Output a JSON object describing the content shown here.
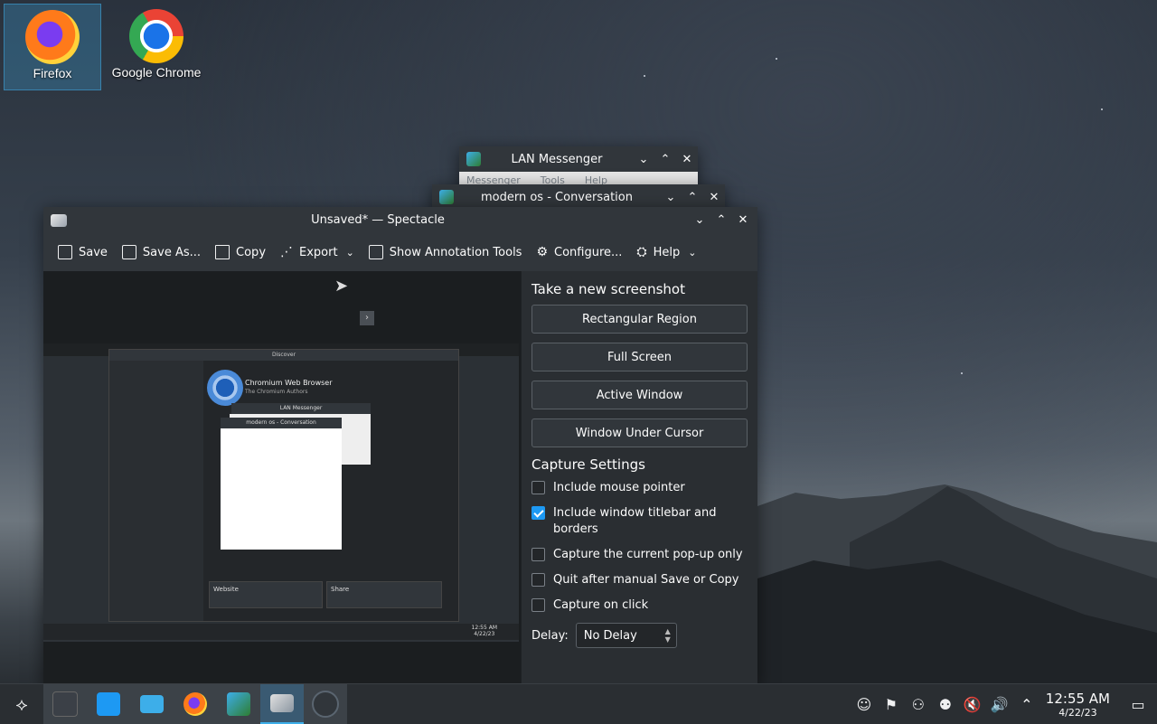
{
  "desktop": {
    "icons": [
      {
        "label": "Firefox",
        "icon": "firefox-icon"
      },
      {
        "label": "Google Chrome",
        "icon": "chrome-icon"
      }
    ]
  },
  "lan_messenger": {
    "title": "LAN Messenger",
    "menu": [
      "Messenger",
      "Tools",
      "Help"
    ]
  },
  "conversation": {
    "title": "modern os - Conversation"
  },
  "spectacle": {
    "title": "Unsaved* — Spectacle",
    "toolbar": {
      "save": "Save",
      "save_as": "Save As...",
      "copy": "Copy",
      "export": "Export",
      "annotate": "Show Annotation Tools",
      "configure": "Configure...",
      "help": "Help"
    },
    "new_screenshot_title": "Take a new screenshot",
    "capture_buttons": [
      "Rectangular Region",
      "Full Screen",
      "Active Window",
      "Window Under Cursor"
    ],
    "capture_settings_title": "Capture Settings",
    "options": [
      {
        "label": "Include mouse pointer",
        "checked": false
      },
      {
        "label": "Include window titlebar and borders",
        "checked": true
      },
      {
        "label": "Capture the current pop-up only",
        "checked": false
      },
      {
        "label": "Quit after manual Save or Copy",
        "checked": false
      },
      {
        "label": "Capture on click",
        "checked": false
      }
    ],
    "delay_label": "Delay:",
    "delay_value": "No Delay"
  },
  "preview_mini": {
    "discover_title": "Discover",
    "app_name": "Chromium Web Browser",
    "app_author": "The Chromium Authors",
    "lan_title": "LAN Messenger",
    "conv_title": "modern os - Conversation",
    "website": "Website",
    "share": "Share",
    "clock_time": "12:55 AM",
    "clock_date": "4/22/23"
  },
  "taskbar": {
    "time": "12:55 AM",
    "date": "4/22/23"
  }
}
